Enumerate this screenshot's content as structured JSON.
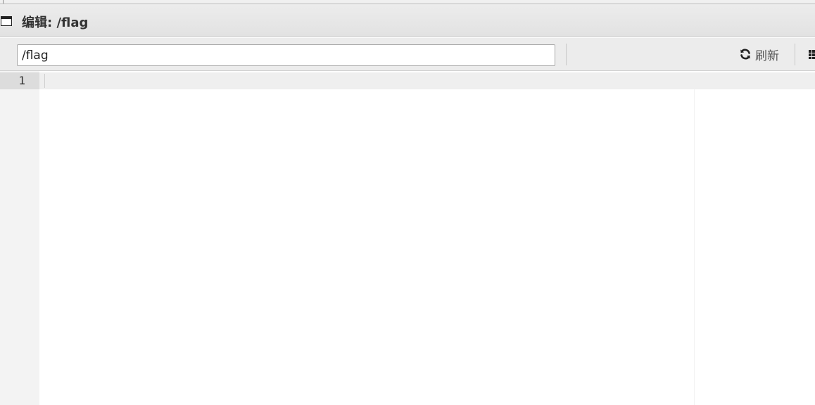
{
  "window": {
    "title": "编辑: /flag",
    "icon": "window-icon"
  },
  "toolbar": {
    "path_value": "/flag",
    "refresh_label": "刷新",
    "refresh_icon": "refresh-icon",
    "more_icon": "grid-icon"
  },
  "editor": {
    "lines": [
      {
        "number": "1",
        "text": ""
      }
    ]
  }
}
